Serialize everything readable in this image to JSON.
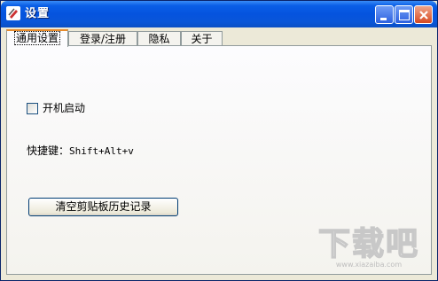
{
  "window": {
    "title": "设置"
  },
  "tabs": [
    {
      "label": "通用设置",
      "active": true
    },
    {
      "label": "登录/注册",
      "active": false
    },
    {
      "label": "隐私",
      "active": false
    },
    {
      "label": "关于",
      "active": false
    }
  ],
  "general": {
    "autostart_label": "开机启动",
    "autostart_checked": false,
    "hotkey_label": "快捷键：",
    "hotkey_value": "Shift+Alt+v",
    "clear_history_button": "清空剪贴板历史记录"
  },
  "watermark": {
    "text": "下载吧"
  },
  "colors": {
    "titlebar": "#0553de",
    "active_tab_accent": "#e68b2c",
    "panel_border": "#919b9c",
    "face": "#ece9d8"
  }
}
